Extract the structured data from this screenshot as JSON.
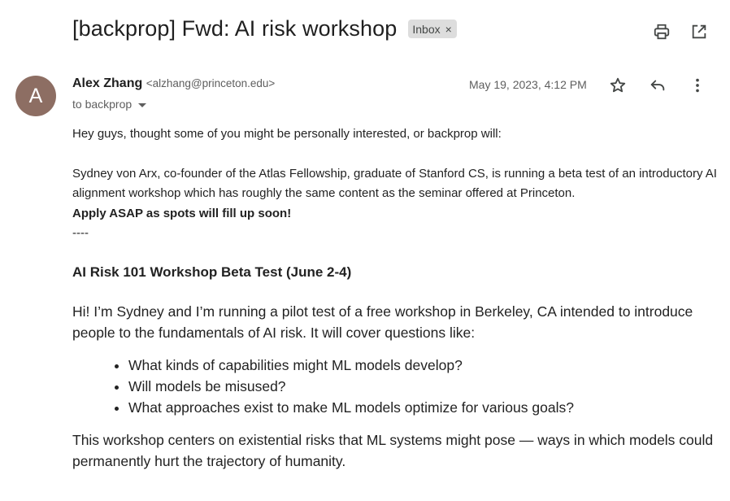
{
  "subject": "[backprop] Fwd: AI risk workshop",
  "label": {
    "text": "Inbox",
    "remove": "×"
  },
  "top_icons": [
    "print-icon",
    "open-in-new-window-icon"
  ],
  "sender": {
    "avatar_letter": "A",
    "avatar_color": "#8d6e63",
    "name": "Alex Zhang",
    "email": "<alzhang@princeton.edu>",
    "to": "to backprop"
  },
  "date": "May 19, 2023, 4:12 PM",
  "header_icons": [
    "star-icon",
    "reply-icon",
    "more-vertical-icon"
  ],
  "body": {
    "greeting": "Hey guys, thought some of you might be personally interested, or backprop will:",
    "forward_note": "Sydney von Arx, co-founder of the Atlas Fellowship, graduate of Stanford CS, is running a beta test of an introductory AI alignment workshop which has roughly the same content as the seminar offered at Princeton.",
    "apply_note": "Apply ASAP as spots will fill up soon!",
    "separator": "----",
    "workshop_title": "AI Risk 101 Workshop Beta Test (June 2-4)",
    "intro": "Hi! I’m Sydney and I’m running a pilot test of a free workshop in Berkeley, CA intended to introduce people to the fundamentals of AI risk. It will cover questions like:",
    "questions": [
      "What kinds of capabilities might ML models develop?",
      "Will models be misused?",
      "What approaches exist to make ML models optimize for various goals?"
    ],
    "outro": "This workshop centers on existential risks that ML systems might pose — ways in which models could permanently hurt the trajectory of humanity."
  }
}
